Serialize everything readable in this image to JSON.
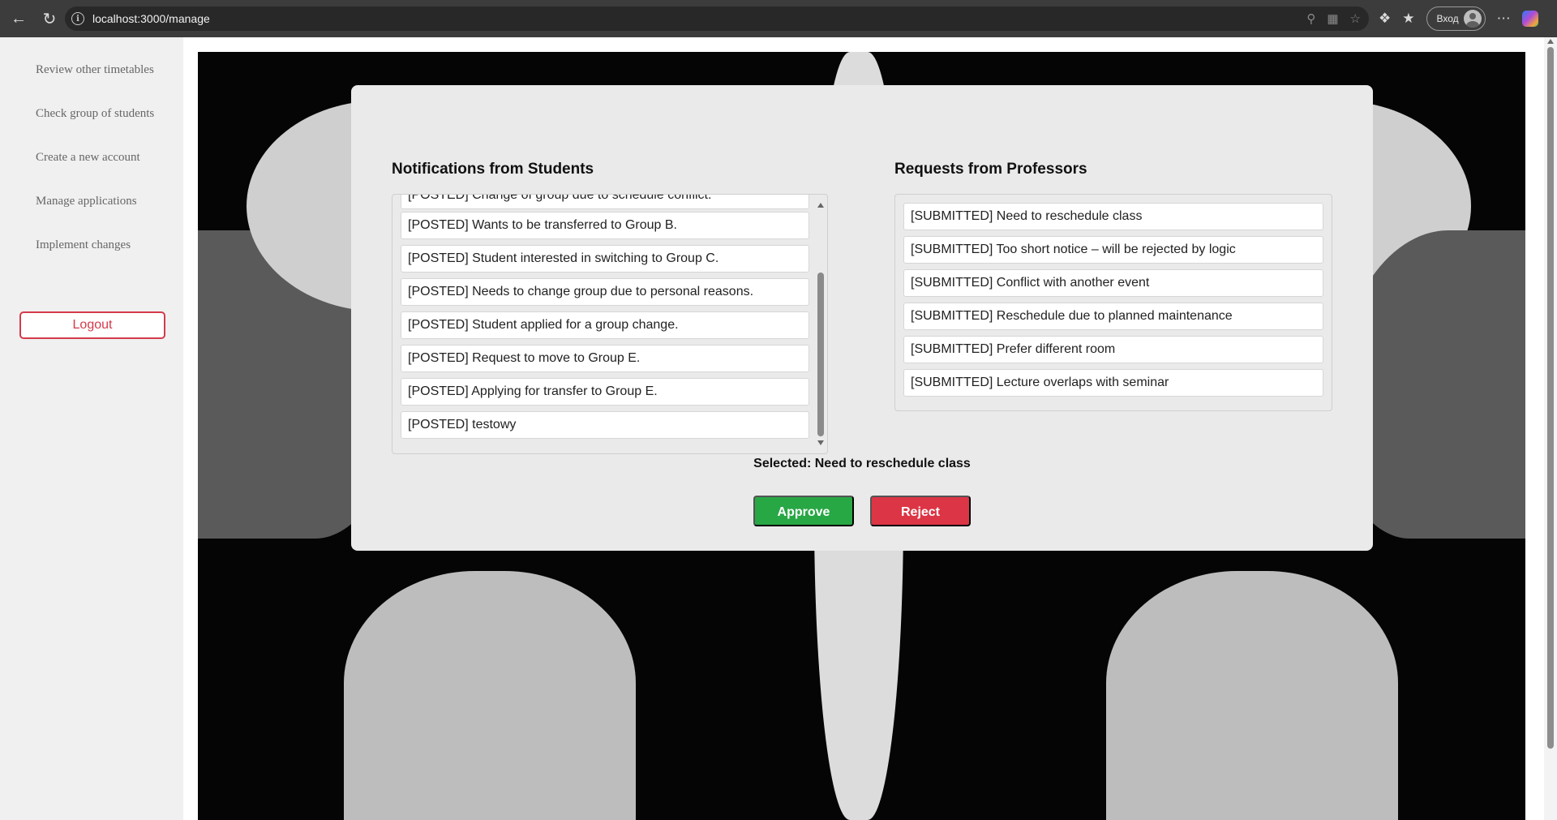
{
  "browser": {
    "url": "localhost:3000/manage",
    "signin_label": "Вход"
  },
  "sidebar": {
    "items": [
      {
        "label": "Review other timetables"
      },
      {
        "label": "Check group of students"
      },
      {
        "label": "Create a new account"
      },
      {
        "label": "Manage applications"
      },
      {
        "label": "Implement changes"
      }
    ],
    "logout_label": "Logout"
  },
  "students": {
    "title": "Notifications from Students",
    "items": [
      "[POSTED] Change of group due to schedule conflict.",
      "[POSTED] Wants to be transferred to Group B.",
      "[POSTED] Student interested in switching to Group C.",
      "[POSTED] Needs to change group due to personal reasons.",
      "[POSTED] Student applied for a group change.",
      "[POSTED] Request to move to Group E.",
      "[POSTED] Applying for transfer to Group E.",
      "[POSTED] testowy"
    ]
  },
  "professors": {
    "title": "Requests from Professors",
    "items": [
      "[SUBMITTED] Need to reschedule class",
      "[SUBMITTED] Too short notice – will be rejected by logic",
      "[SUBMITTED] Conflict with another event",
      "[SUBMITTED] Reschedule due to planned maintenance",
      "[SUBMITTED] Prefer different room",
      "[SUBMITTED] Lecture overlaps with seminar"
    ]
  },
  "selection": {
    "text": "Selected: Need to reschedule class"
  },
  "actions": {
    "approve_label": "Approve",
    "reject_label": "Reject"
  },
  "colors": {
    "approve": "#28a745",
    "reject": "#dc3545",
    "panel": "#eaeaea"
  }
}
